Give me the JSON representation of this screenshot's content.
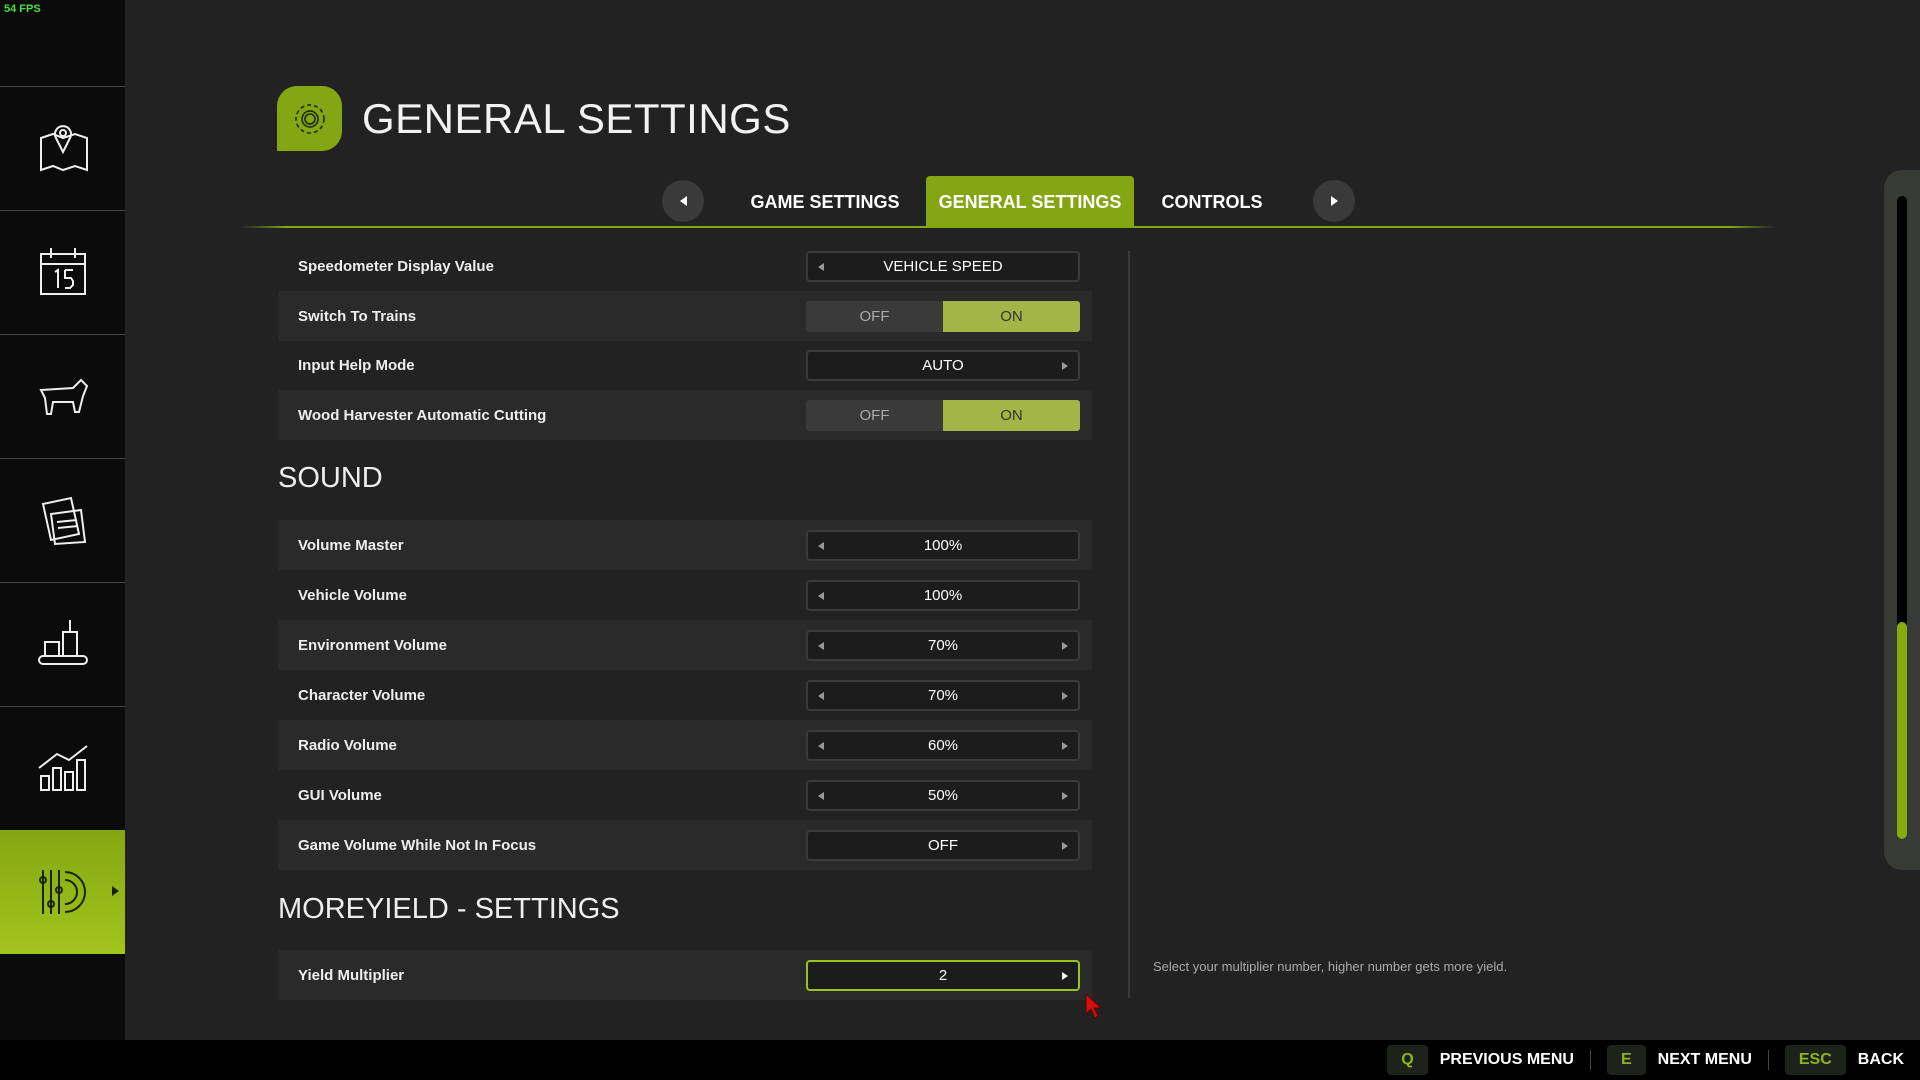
{
  "fps": "54 FPS",
  "header": {
    "title": "GENERAL SETTINGS",
    "icon": "gear-icon"
  },
  "sidebar": {
    "items": [
      {
        "icon": "map-icon"
      },
      {
        "icon": "calendar-icon"
      },
      {
        "icon": "animals-icon"
      },
      {
        "icon": "contracts-icon"
      },
      {
        "icon": "production-icon"
      },
      {
        "icon": "statistics-icon"
      },
      {
        "icon": "settings-icon",
        "active": true
      }
    ]
  },
  "tabs": [
    {
      "label": "GAME SETTINGS"
    },
    {
      "label": "GENERAL SETTINGS",
      "active": true
    },
    {
      "label": "CONTROLS"
    }
  ],
  "general": [
    {
      "label": "Speedometer Display Value",
      "type": "select",
      "value": "VEHICLE SPEED"
    },
    {
      "label": "Switch To Trains",
      "type": "toggle",
      "off": "OFF",
      "on": "ON",
      "value": "ON"
    },
    {
      "label": "Input Help Mode",
      "type": "select",
      "value": "AUTO"
    },
    {
      "label": "Wood Harvester Automatic Cutting",
      "type": "toggle",
      "off": "OFF",
      "on": "ON",
      "value": "ON"
    }
  ],
  "sound": {
    "title": "SOUND",
    "rows": [
      {
        "label": "Volume Master",
        "value": "100%"
      },
      {
        "label": "Vehicle Volume",
        "value": "100%"
      },
      {
        "label": "Environment Volume",
        "value": "70%"
      },
      {
        "label": "Character Volume",
        "value": "70%"
      },
      {
        "label": "Radio Volume",
        "value": "60%"
      },
      {
        "label": "GUI Volume",
        "value": "50%"
      },
      {
        "label": "Game Volume While Not In Focus",
        "value": "OFF"
      }
    ]
  },
  "moreyield": {
    "title": "MOREYIELD - SETTINGS",
    "rows": [
      {
        "label": "Yield Multiplier",
        "value": "2"
      }
    ]
  },
  "help_text": "Select your multiplier number, higher number gets more yield.",
  "bottom": [
    {
      "key": "Q",
      "label": "PREVIOUS MENU"
    },
    {
      "key": "E",
      "label": "NEXT MENU"
    },
    {
      "key": "ESC",
      "label": "BACK"
    }
  ],
  "colors": {
    "accent": "#84a612",
    "toggle_on": "#a4b548",
    "fps": "#3fe03f"
  }
}
